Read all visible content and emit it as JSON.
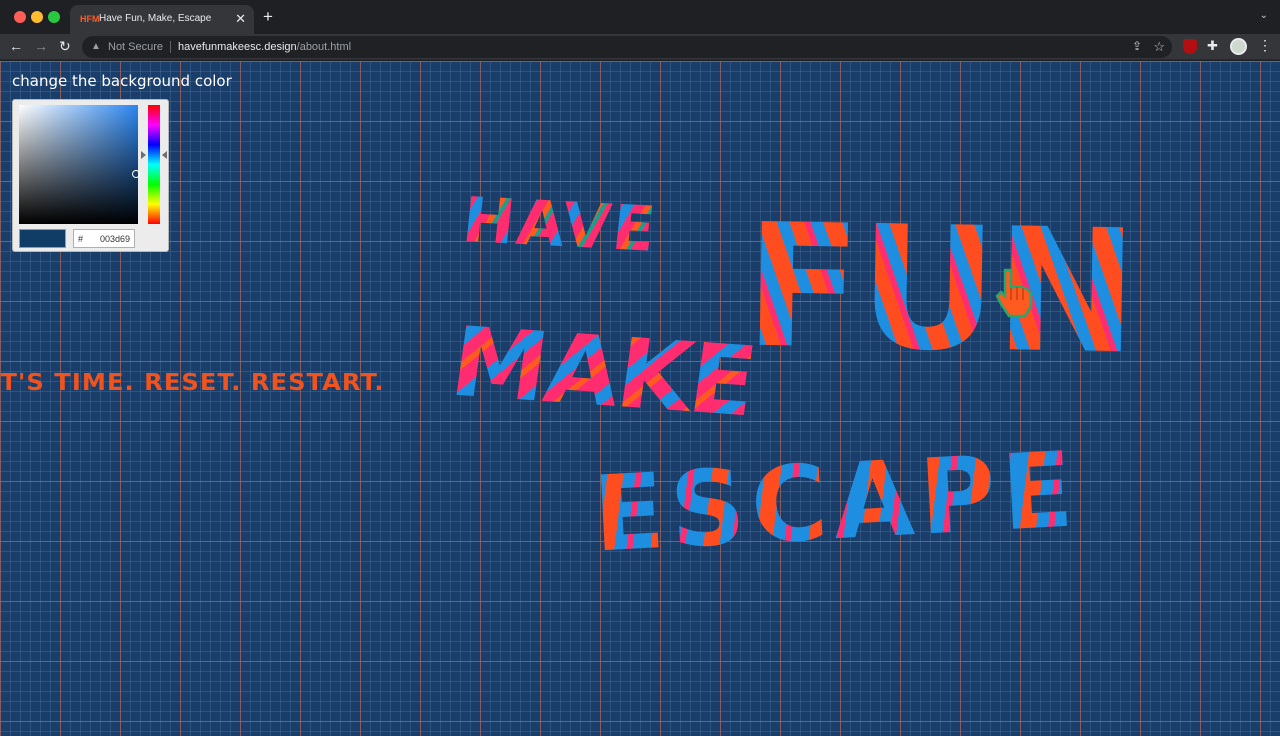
{
  "browser": {
    "tab_title": "Have Fun, Make, Escape",
    "tab_favicon": "HFM",
    "new_tab_glyph": "+",
    "security_label": "Not Secure",
    "url_host": "havefunmakeesc.design",
    "url_path": "/about.html"
  },
  "page": {
    "background_color": "#003d69",
    "bg_label": "change the background color",
    "color_picker": {
      "hex_prefix": "#",
      "hex_value": "003d69"
    },
    "tagline": "'T'S TIME. RESET. RESTART.",
    "artwork_words": {
      "have": "HAVE",
      "fun": "FUN",
      "make": "MAKE",
      "escape": "ESCAPE"
    },
    "palette": {
      "pink": "#ff2d6f",
      "orange": "#ff4d1f",
      "blue": "#1e8fe0",
      "teal": "#19a08c"
    }
  }
}
